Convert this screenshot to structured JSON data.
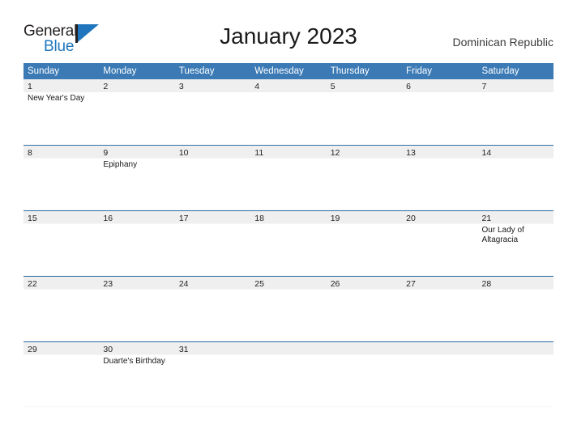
{
  "brand": {
    "word_one": "General",
    "word_two": "Blue",
    "flag_color": "#1f76bc",
    "text_color": "#231f20"
  },
  "header": {
    "title": "January 2023",
    "country": "Dominican Republic"
  },
  "theme": {
    "header_blue": "#3b7ab5",
    "row_line_blue": "#2f6ea5",
    "date_band_gray": "#efefef"
  },
  "calendar": {
    "weekday_headers": [
      "Sunday",
      "Monday",
      "Tuesday",
      "Wednesday",
      "Thursday",
      "Friday",
      "Saturday"
    ],
    "weeks": [
      [
        {
          "day": "1",
          "event": "New Year's Day"
        },
        {
          "day": "2",
          "event": ""
        },
        {
          "day": "3",
          "event": ""
        },
        {
          "day": "4",
          "event": ""
        },
        {
          "day": "5",
          "event": ""
        },
        {
          "day": "6",
          "event": ""
        },
        {
          "day": "7",
          "event": ""
        }
      ],
      [
        {
          "day": "8",
          "event": ""
        },
        {
          "day": "9",
          "event": "Epiphany"
        },
        {
          "day": "10",
          "event": ""
        },
        {
          "day": "11",
          "event": ""
        },
        {
          "day": "12",
          "event": ""
        },
        {
          "day": "13",
          "event": ""
        },
        {
          "day": "14",
          "event": ""
        }
      ],
      [
        {
          "day": "15",
          "event": ""
        },
        {
          "day": "16",
          "event": ""
        },
        {
          "day": "17",
          "event": ""
        },
        {
          "day": "18",
          "event": ""
        },
        {
          "day": "19",
          "event": ""
        },
        {
          "day": "20",
          "event": ""
        },
        {
          "day": "21",
          "event": "Our Lady of Altagracia"
        }
      ],
      [
        {
          "day": "22",
          "event": ""
        },
        {
          "day": "23",
          "event": ""
        },
        {
          "day": "24",
          "event": ""
        },
        {
          "day": "25",
          "event": ""
        },
        {
          "day": "26",
          "event": ""
        },
        {
          "day": "27",
          "event": ""
        },
        {
          "day": "28",
          "event": ""
        }
      ],
      [
        {
          "day": "29",
          "event": ""
        },
        {
          "day": "30",
          "event": "Duarte's Birthday"
        },
        {
          "day": "31",
          "event": ""
        },
        {
          "day": "",
          "event": ""
        },
        {
          "day": "",
          "event": ""
        },
        {
          "day": "",
          "event": ""
        },
        {
          "day": "",
          "event": ""
        }
      ]
    ]
  }
}
